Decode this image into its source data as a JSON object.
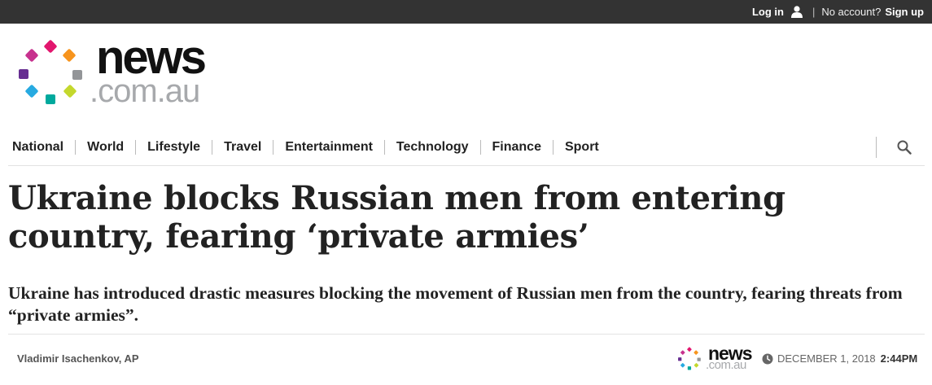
{
  "topbar": {
    "login_label": "Log in",
    "separator": "|",
    "no_account_text": "No account?",
    "signup_label": "Sign up"
  },
  "brand": {
    "name": "news",
    "domain": ".com.au",
    "dot_colors": [
      "#e2166e",
      "#f7941d",
      "#939598",
      "#c4d82d",
      "#00a99d",
      "#27aae1",
      "#662d91",
      "#c7328e"
    ]
  },
  "nav": {
    "items": [
      "National",
      "World",
      "Lifestyle",
      "Travel",
      "Entertainment",
      "Technology",
      "Finance",
      "Sport"
    ],
    "search_icon": "search-icon"
  },
  "article": {
    "headline": "Ukraine blocks Russian men from entering country, fearing ‘private armies’",
    "standfirst": "Ukraine has introduced drastic measures blocking the movement of Russian men from the country, fearing threats from “private armies”.",
    "byline": "Vladimir Isachenkov, AP",
    "source_brand": "news",
    "source_domain": ".com.au",
    "date": "DECEMBER 1, 2018",
    "time": "2:44PM"
  }
}
